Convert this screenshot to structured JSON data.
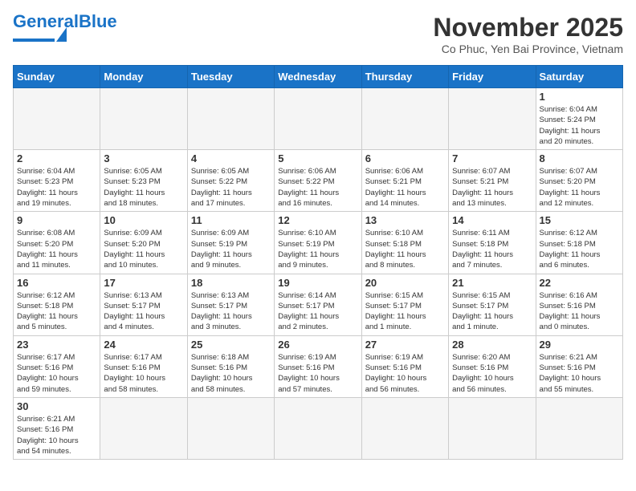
{
  "header": {
    "logo_general": "General",
    "logo_blue": "Blue",
    "month_title": "November 2025",
    "location": "Co Phuc, Yen Bai Province, Vietnam"
  },
  "weekdays": [
    "Sunday",
    "Monday",
    "Tuesday",
    "Wednesday",
    "Thursday",
    "Friday",
    "Saturday"
  ],
  "days": [
    {
      "num": "",
      "info": "",
      "empty": true
    },
    {
      "num": "",
      "info": "",
      "empty": true
    },
    {
      "num": "",
      "info": "",
      "empty": true
    },
    {
      "num": "",
      "info": "",
      "empty": true
    },
    {
      "num": "",
      "info": "",
      "empty": true
    },
    {
      "num": "",
      "info": "",
      "empty": true
    },
    {
      "num": "1",
      "info": "Sunrise: 6:04 AM\nSunset: 5:24 PM\nDaylight: 11 hours\nand 20 minutes."
    },
    {
      "num": "2",
      "info": "Sunrise: 6:04 AM\nSunset: 5:23 PM\nDaylight: 11 hours\nand 19 minutes."
    },
    {
      "num": "3",
      "info": "Sunrise: 6:05 AM\nSunset: 5:23 PM\nDaylight: 11 hours\nand 18 minutes."
    },
    {
      "num": "4",
      "info": "Sunrise: 6:05 AM\nSunset: 5:22 PM\nDaylight: 11 hours\nand 17 minutes."
    },
    {
      "num": "5",
      "info": "Sunrise: 6:06 AM\nSunset: 5:22 PM\nDaylight: 11 hours\nand 16 minutes."
    },
    {
      "num": "6",
      "info": "Sunrise: 6:06 AM\nSunset: 5:21 PM\nDaylight: 11 hours\nand 14 minutes."
    },
    {
      "num": "7",
      "info": "Sunrise: 6:07 AM\nSunset: 5:21 PM\nDaylight: 11 hours\nand 13 minutes."
    },
    {
      "num": "8",
      "info": "Sunrise: 6:07 AM\nSunset: 5:20 PM\nDaylight: 11 hours\nand 12 minutes."
    },
    {
      "num": "9",
      "info": "Sunrise: 6:08 AM\nSunset: 5:20 PM\nDaylight: 11 hours\nand 11 minutes."
    },
    {
      "num": "10",
      "info": "Sunrise: 6:09 AM\nSunset: 5:20 PM\nDaylight: 11 hours\nand 10 minutes."
    },
    {
      "num": "11",
      "info": "Sunrise: 6:09 AM\nSunset: 5:19 PM\nDaylight: 11 hours\nand 9 minutes."
    },
    {
      "num": "12",
      "info": "Sunrise: 6:10 AM\nSunset: 5:19 PM\nDaylight: 11 hours\nand 9 minutes."
    },
    {
      "num": "13",
      "info": "Sunrise: 6:10 AM\nSunset: 5:18 PM\nDaylight: 11 hours\nand 8 minutes."
    },
    {
      "num": "14",
      "info": "Sunrise: 6:11 AM\nSunset: 5:18 PM\nDaylight: 11 hours\nand 7 minutes."
    },
    {
      "num": "15",
      "info": "Sunrise: 6:12 AM\nSunset: 5:18 PM\nDaylight: 11 hours\nand 6 minutes."
    },
    {
      "num": "16",
      "info": "Sunrise: 6:12 AM\nSunset: 5:18 PM\nDaylight: 11 hours\nand 5 minutes."
    },
    {
      "num": "17",
      "info": "Sunrise: 6:13 AM\nSunset: 5:17 PM\nDaylight: 11 hours\nand 4 minutes."
    },
    {
      "num": "18",
      "info": "Sunrise: 6:13 AM\nSunset: 5:17 PM\nDaylight: 11 hours\nand 3 minutes."
    },
    {
      "num": "19",
      "info": "Sunrise: 6:14 AM\nSunset: 5:17 PM\nDaylight: 11 hours\nand 2 minutes."
    },
    {
      "num": "20",
      "info": "Sunrise: 6:15 AM\nSunset: 5:17 PM\nDaylight: 11 hours\nand 1 minute."
    },
    {
      "num": "21",
      "info": "Sunrise: 6:15 AM\nSunset: 5:17 PM\nDaylight: 11 hours\nand 1 minute."
    },
    {
      "num": "22",
      "info": "Sunrise: 6:16 AM\nSunset: 5:16 PM\nDaylight: 11 hours\nand 0 minutes."
    },
    {
      "num": "23",
      "info": "Sunrise: 6:17 AM\nSunset: 5:16 PM\nDaylight: 10 hours\nand 59 minutes."
    },
    {
      "num": "24",
      "info": "Sunrise: 6:17 AM\nSunset: 5:16 PM\nDaylight: 10 hours\nand 58 minutes."
    },
    {
      "num": "25",
      "info": "Sunrise: 6:18 AM\nSunset: 5:16 PM\nDaylight: 10 hours\nand 58 minutes."
    },
    {
      "num": "26",
      "info": "Sunrise: 6:19 AM\nSunset: 5:16 PM\nDaylight: 10 hours\nand 57 minutes."
    },
    {
      "num": "27",
      "info": "Sunrise: 6:19 AM\nSunset: 5:16 PM\nDaylight: 10 hours\nand 56 minutes."
    },
    {
      "num": "28",
      "info": "Sunrise: 6:20 AM\nSunset: 5:16 PM\nDaylight: 10 hours\nand 56 minutes."
    },
    {
      "num": "29",
      "info": "Sunrise: 6:21 AM\nSunset: 5:16 PM\nDaylight: 10 hours\nand 55 minutes."
    },
    {
      "num": "30",
      "info": "Sunrise: 6:21 AM\nSunset: 5:16 PM\nDaylight: 10 hours\nand 54 minutes."
    },
    {
      "num": "",
      "info": "",
      "empty": true
    },
    {
      "num": "",
      "info": "",
      "empty": true
    },
    {
      "num": "",
      "info": "",
      "empty": true
    },
    {
      "num": "",
      "info": "",
      "empty": true
    },
    {
      "num": "",
      "info": "",
      "empty": true
    },
    {
      "num": "",
      "info": "",
      "empty": true
    }
  ]
}
